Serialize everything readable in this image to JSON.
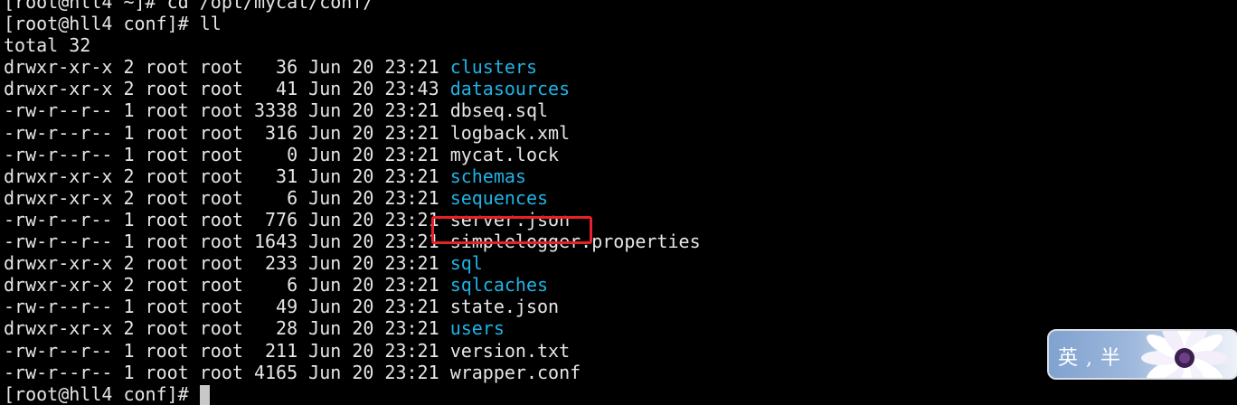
{
  "terminal": {
    "lines": [
      {
        "prompt": "[root@hll4 ~]# ",
        "command": "cd /opt/mycat/conf/"
      },
      {
        "prompt": "[root@hll4 conf]# ",
        "command": "ll"
      },
      {
        "text": "total 32"
      }
    ],
    "entries": [
      {
        "meta": "drwxr-xr-x 2 root root   36 Jun 20 23:21 ",
        "name": "clusters",
        "type": "dir"
      },
      {
        "meta": "drwxr-xr-x 2 root root   41 Jun 20 23:43 ",
        "name": "datasources",
        "type": "dir"
      },
      {
        "meta": "-rw-r--r-- 1 root root 3338 Jun 20 23:21 ",
        "name": "dbseq.sql",
        "type": "file"
      },
      {
        "meta": "-rw-r--r-- 1 root root  316 Jun 20 23:21 ",
        "name": "logback.xml",
        "type": "file"
      },
      {
        "meta": "-rw-r--r-- 1 root root    0 Jun 20 23:21 ",
        "name": "mycat.lock",
        "type": "file"
      },
      {
        "meta": "drwxr-xr-x 2 root root   31 Jun 20 23:21 ",
        "name": "schemas",
        "type": "dir"
      },
      {
        "meta": "drwxr-xr-x 2 root root    6 Jun 20 23:21 ",
        "name": "sequences",
        "type": "dir"
      },
      {
        "meta": "-rw-r--r-- 1 root root  776 Jun 20 23:21 ",
        "name": "server.json",
        "type": "file"
      },
      {
        "meta": "-rw-r--r-- 1 root root 1643 Jun 20 23:21 ",
        "name": "simplelogger.properties",
        "type": "file"
      },
      {
        "meta": "drwxr-xr-x 2 root root  233 Jun 20 23:21 ",
        "name": "sql",
        "type": "dir"
      },
      {
        "meta": "drwxr-xr-x 2 root root    6 Jun 20 23:21 ",
        "name": "sqlcaches",
        "type": "dir"
      },
      {
        "meta": "-rw-r--r-- 1 root root   49 Jun 20 23:21 ",
        "name": "state.json",
        "type": "file"
      },
      {
        "meta": "drwxr-xr-x 2 root root   28 Jun 20 23:21 ",
        "name": "users",
        "type": "dir"
      },
      {
        "meta": "-rw-r--r-- 1 root root  211 Jun 20 23:21 ",
        "name": "version.txt",
        "type": "file"
      },
      {
        "meta": "-rw-r--r-- 1 root root 4165 Jun 20 23:21 ",
        "name": "wrapper.conf",
        "type": "file"
      }
    ],
    "final_prompt": "[root@hll4 conf]# "
  },
  "colors": {
    "background": "#000000",
    "text": "#e6e6e6",
    "directory": "#1fb3e6",
    "highlight_border": "#e8202a"
  },
  "ime": {
    "label": "英 , 半",
    "icon": "flower-icon"
  }
}
